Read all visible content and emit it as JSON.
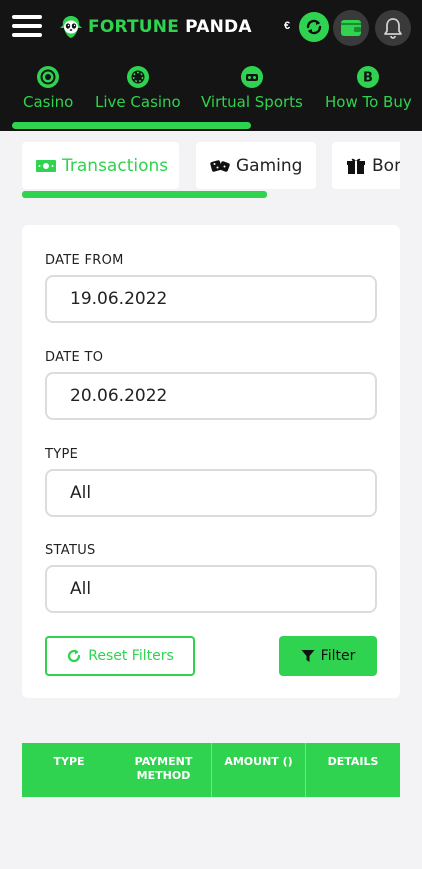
{
  "header": {
    "brand_part1": "FORTUNE",
    "brand_part2": "PANDA",
    "currency_symbol": "€",
    "icons": [
      "menu-icon",
      "refresh-icon",
      "wallet-icon",
      "bell-icon"
    ]
  },
  "categories": [
    {
      "label": "Casino",
      "icon": "casino-chip-icon"
    },
    {
      "label": "Live Casino",
      "icon": "poker-chip-icon"
    },
    {
      "label": "Virtual Sports",
      "icon": "vr-headset-icon"
    },
    {
      "label": "How To Buy",
      "icon": "bitcoin-icon"
    }
  ],
  "tabs": [
    {
      "label": "Transactions",
      "icon": "banknote-icon",
      "active": true
    },
    {
      "label": "Gaming",
      "icon": "dice-icon",
      "active": false
    },
    {
      "label": "Bon",
      "icon": "gift-icon",
      "active": false
    }
  ],
  "filters": {
    "date_from_label": "DATE FROM",
    "date_from_value": "19.06.2022",
    "date_to_label": "DATE TO",
    "date_to_value": "20.06.2022",
    "type_label": "TYPE",
    "type_value": "All",
    "status_label": "STATUS",
    "status_value": "All",
    "reset_label": "Reset Filters",
    "filter_label": "Filter"
  },
  "table": {
    "columns": [
      "TYPE",
      "PAYMENT METHOD",
      "AMOUNT ()",
      "DETAILS"
    ]
  },
  "colors": {
    "accent": "#2fd34f",
    "header_bg": "#141414",
    "page_bg": "#f3f3f5"
  }
}
